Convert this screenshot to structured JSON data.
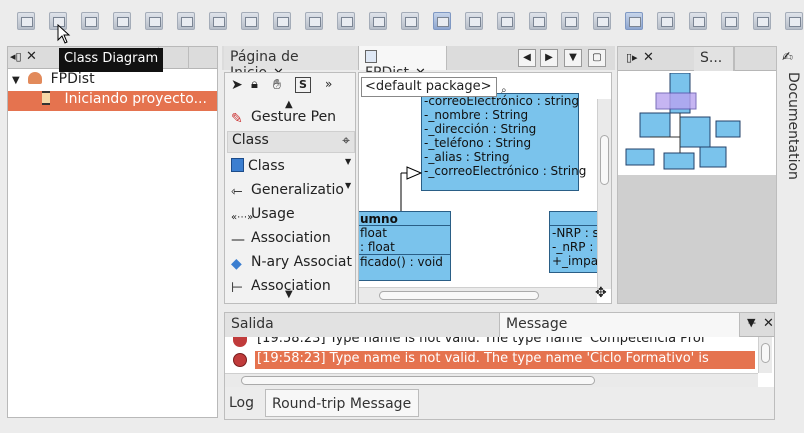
{
  "tooltip": {
    "text": "Class Diagram"
  },
  "toolbar": {
    "icons": [
      "diagram-icon",
      "class-icon",
      "package-icon",
      "use-case-icon",
      "sequence-icon",
      "collab-icon",
      "state-icon",
      "activity-icon",
      "component-icon",
      "deploy-icon",
      "profile-icon",
      "frame-icon",
      "note-icon",
      "table-icon",
      "tree-icon",
      "view-icon",
      "db-icon",
      "layout-icon",
      "layout2-icon",
      "layout3-icon",
      "layout4-icon",
      "layout5-icon",
      "layout6-icon",
      "layout7-icon",
      "layout8-icon"
    ]
  },
  "projects": {
    "tree": [
      {
        "label": "FPDist",
        "icon": "project-icon"
      },
      {
        "label": "Iniciando proyecto...",
        "icon": "hourglass-icon"
      }
    ]
  },
  "editor_tabs": [
    {
      "label": "Página de Inicio"
    },
    {
      "label": "FPDist"
    }
  ],
  "navigator_tabs": [
    {
      "label": "S..."
    }
  ],
  "palette": {
    "search_placeholder": "<default package>",
    "sections": [
      {
        "label": "Gesture Pen"
      },
      {
        "label": "Class"
      }
    ],
    "items": [
      {
        "label": "Class"
      },
      {
        "label": "Generalizatio"
      },
      {
        "label": "Usage"
      },
      {
        "label": "Association"
      },
      {
        "label": "N-ary Associat"
      },
      {
        "label": "Association Cla"
      }
    ]
  },
  "diagram": {
    "class_top_lines": [
      "-correoElectrónico : string",
      "-_nombre : String",
      "-_dirección : String",
      "-_teléfono : String",
      "-_alias : String",
      "-_correoElectrónico : String"
    ],
    "alumno": {
      "name": "umno",
      "attrs": [
        "float",
        ": float"
      ],
      "ops": [
        "ficado() : void"
      ]
    },
    "profe": {
      "attrs": [
        "-NRP : s",
        "-_nRP : S",
        "+_impa"
      ]
    }
  },
  "output": {
    "tabs": [
      {
        "label": "Salida"
      },
      {
        "label": "Message"
      }
    ],
    "rows": [
      {
        "text": "[19:58:23]  Type name is not valid. The type name 'Competencia Prof"
      },
      {
        "text": "[19:58:23]  Type name is not valid. The type name 'Ciclo Formativo' is"
      }
    ],
    "bottom_tabs": [
      {
        "label": "Log"
      },
      {
        "label": "Round-trip Message"
      }
    ]
  },
  "documentation": {
    "label": "Documentation"
  }
}
